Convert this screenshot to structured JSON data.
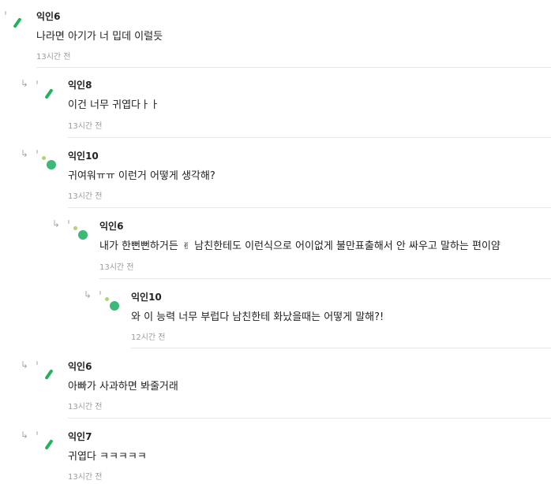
{
  "comments": [
    {
      "author": "익인6",
      "text": "나라면 아기가 너 밉데 이럴듯",
      "time": "13시간 전"
    },
    {
      "author": "익인8",
      "text": "이건 너무 귀엽다ㅏㅏ",
      "time": "13시간 전"
    },
    {
      "author": "익인10",
      "text": "귀여워ㅠㅠ 이런거 어떻게 생각해?",
      "time": "13시간 전"
    },
    {
      "author": "익인6",
      "text_pre": "내가 한뻔뻔하거든",
      "emoji": "✌",
      "text_post": "남친한테도 이런식으로 어이없게 불만표출해서 안 싸우고 말하는 편이얌",
      "time": "13시간 전"
    },
    {
      "author": "익인10",
      "text": "와 이 능력 너무 부럽다 남친한테 화났을때는 어떻게 말해?!",
      "time": "12시간 전"
    },
    {
      "author": "익인6",
      "text": "아빠가 사과하면 봐줄거래",
      "time": "13시간 전"
    },
    {
      "author": "익인7",
      "text": "귀엽다 ㅋㅋㅋㅋㅋ",
      "time": "13시간 전"
    }
  ],
  "icons": {
    "reply_arrow": "reply-arrow-icon",
    "avatar": "avatar-icon"
  },
  "colors": {
    "avatar_green": "#22b35a",
    "avatar_light_green": "#a9d96b",
    "time_gray": "#9b9b9b"
  }
}
